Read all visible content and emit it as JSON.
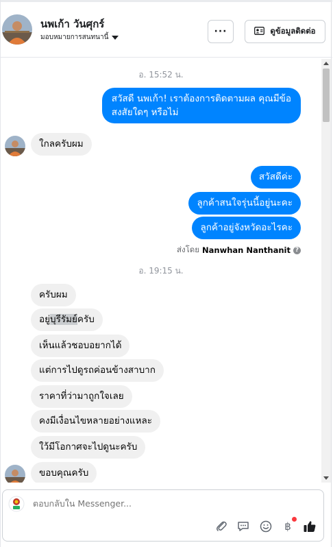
{
  "header": {
    "name": "นพเก้า วันศุกร์",
    "assign_label": "มอบหมายการสนทนานี้",
    "more_label": "···",
    "contact_label": "ดูข้อมูลติดต่อ"
  },
  "messages": {
    "timestamp_1": "อ. 15:52 น.",
    "out_1_line1": "สวัสดี นพเก้า! เราต้องการติดตามผล คุณมีข้อ",
    "out_1_line2": "สงสัยใดๆ หรือไม่",
    "in_1": "ใกลครับผม",
    "out_2": "สวัสดีค่ะ",
    "out_3": "ลูกค้าสนใจรุ่นนี้อยู่นะคะ",
    "out_4": "ลูกค้าอยู่จังหวัดอะไรคะ",
    "sent_by_prefix": "ส่งโดย",
    "sent_by_name": "Nanwhan Nanthanit",
    "timestamp_2": "อ. 19:15 น.",
    "in_2": "ครับผม",
    "in_3_a": "อยู่",
    "in_3_b": "บุรีรัมย์",
    "in_3_c": "ครับ",
    "in_4": "เห็นแล้วชอบอยากได้",
    "in_5": "แต่การไปดูรถค่อนข้างสาบาก",
    "in_6": "ราคาที่ว่ามาถูกใจเลย",
    "in_7": "คงมีเงื่อนไขหลายอย่างแหละ",
    "in_8": "ใว้มีโอกาศจะไปดูนะครับ",
    "in_9": "ขอบคุณครับ"
  },
  "composer": {
    "placeholder": "ตอบกลับใน Messenger..."
  },
  "colors": {
    "outgoing": "#0084ff",
    "incoming": "#f0f0f0",
    "notification_dot": "#fa383e"
  },
  "icons": [
    "avatar",
    "chevron-down-icon",
    "contact-card-icon",
    "info-icon",
    "attach-icon",
    "saved-reply-icon",
    "emoji-icon",
    "baht-icon",
    "thumbs-up-icon"
  ]
}
